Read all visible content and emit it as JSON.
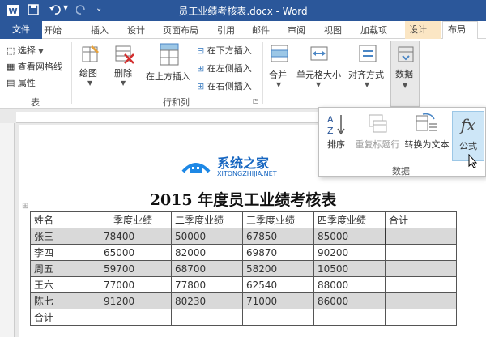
{
  "window": {
    "title": "员工业绩考核表.docx - Word"
  },
  "tabs": [
    "文件",
    "开始",
    "插入",
    "设计",
    "页面布局",
    "引用",
    "邮件",
    "审阅",
    "视图",
    "加载项",
    "设计",
    "布局"
  ],
  "ribbon": {
    "table_group": {
      "select": "选择",
      "gridlines": "查看网格线",
      "properties": "属性",
      "label": "表"
    },
    "draw": "绘图",
    "delete": "删除",
    "insert_above": "在上方插入",
    "insert_below": "在下方插入",
    "insert_left": "在左侧插入",
    "insert_right": "在右侧插入",
    "rows_cols_label": "行和列",
    "merge": "合并",
    "cell_size": "单元格大小",
    "alignment": "对齐方式",
    "data": "数据"
  },
  "data_popup": {
    "sort": "排序",
    "repeat_header": "重复标题行",
    "convert": "转换为文本",
    "formula": "公式",
    "label": "数据",
    "formula_symbol": "fx"
  },
  "watermark": {
    "name": "系统之家",
    "url": "XITONGZHIJIA.NET"
  },
  "document": {
    "heading": "2015 年度员工业绩考核表",
    "table": {
      "headers": [
        "姓名",
        "一季度业绩",
        "二季度业绩",
        "三季度业绩",
        "四季度业绩",
        "合计"
      ],
      "rows": [
        [
          "张三",
          "78400",
          "50000",
          "67850",
          "85000",
          ""
        ],
        [
          "李四",
          "65000",
          "82000",
          "69870",
          "90200",
          ""
        ],
        [
          "周五",
          "59700",
          "68700",
          "58200",
          "10500",
          ""
        ],
        [
          "王六",
          "77000",
          "77800",
          "62540",
          "88000",
          ""
        ],
        [
          "陈七",
          "91200",
          "80230",
          "71000",
          "86000",
          ""
        ],
        [
          "合计",
          "",
          "",
          "",
          "",
          ""
        ]
      ]
    }
  },
  "colors": {
    "title_bar": "#2b579a",
    "context_tab": "#fbe6c4",
    "active_button": "#cde6f7",
    "shaded_row": "#d9d9d9"
  }
}
